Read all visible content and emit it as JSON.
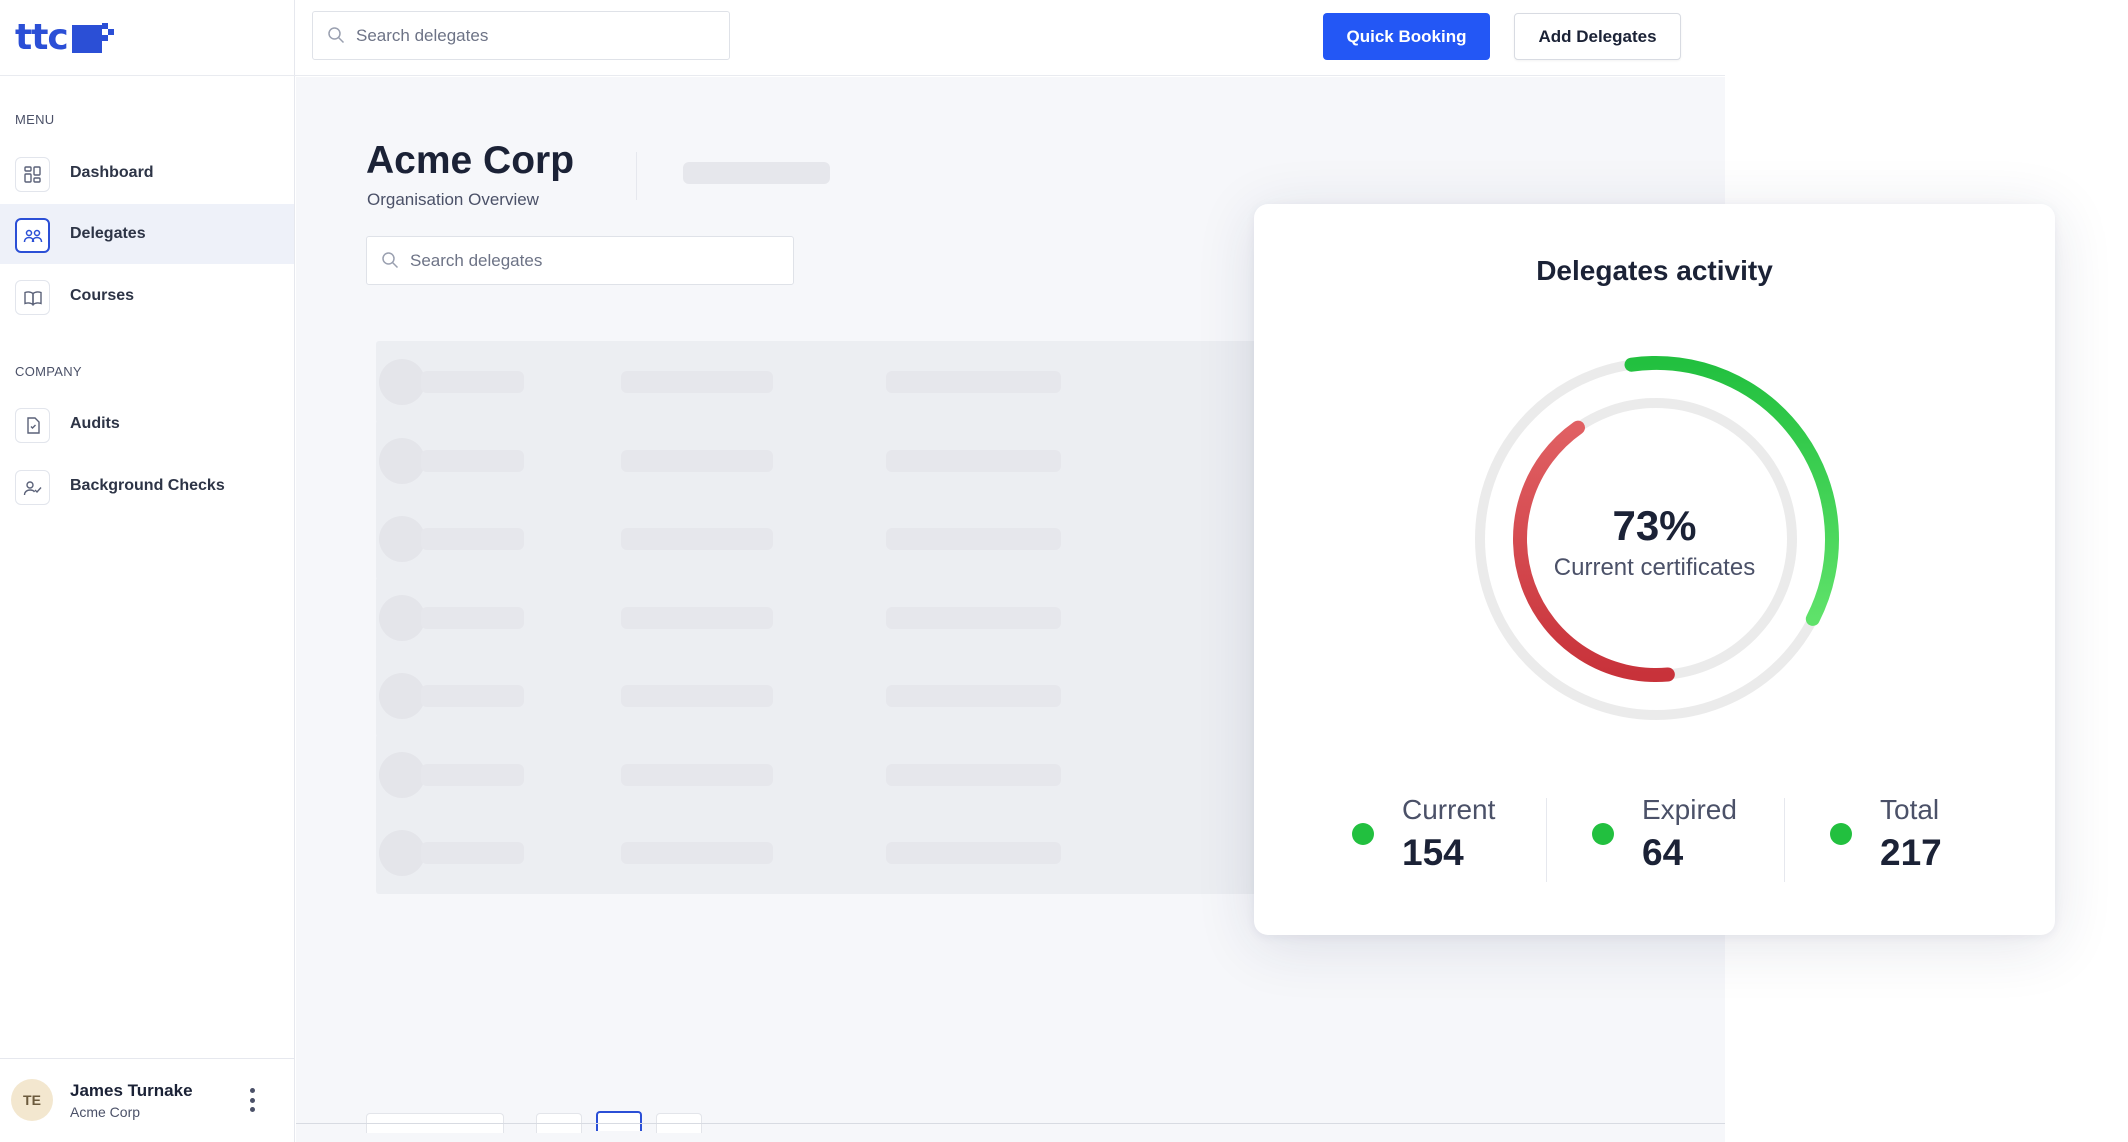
{
  "brand": {
    "name": "ttc",
    "color": "#2b4fd6"
  },
  "sidebar": {
    "menu_label": "MENU",
    "company_label": "COMPANY",
    "menu_items": [
      {
        "label": "Dashboard",
        "icon": "dashboard-grid-icon",
        "active": false
      },
      {
        "label": "Delegates",
        "icon": "people-icon",
        "active": true
      },
      {
        "label": "Courses",
        "icon": "book-icon",
        "active": false
      }
    ],
    "company_items": [
      {
        "label": "Audits",
        "icon": "document-icon",
        "active": false
      },
      {
        "label": "Background Checks",
        "icon": "user-check-icon",
        "active": false
      }
    ],
    "user": {
      "initials": "TE",
      "name": "James Turnake",
      "org": "Acme Corp"
    }
  },
  "topbar": {
    "search_placeholder": "Search delegates",
    "quick_booking_label": "Quick Booking",
    "add_delegates_label": "Add Delegates"
  },
  "main": {
    "title": "Acme Corp",
    "subtitle": "Organisation Overview",
    "search_placeholder": "Search delegates"
  },
  "activity_card": {
    "title": "Delegates activity",
    "percent_label": "73%",
    "caption": "Current certificates",
    "current_fraction": 0.73,
    "expired_fraction": 0.5,
    "stats": [
      {
        "label": "Current",
        "value": "154"
      },
      {
        "label": "Expired",
        "value": "64"
      },
      {
        "label": "Total",
        "value": "217"
      }
    ],
    "colors": {
      "current": "#22c03f",
      "expired": "#d63c44",
      "track": "#ebebeb",
      "accent": "#2357f5"
    }
  }
}
